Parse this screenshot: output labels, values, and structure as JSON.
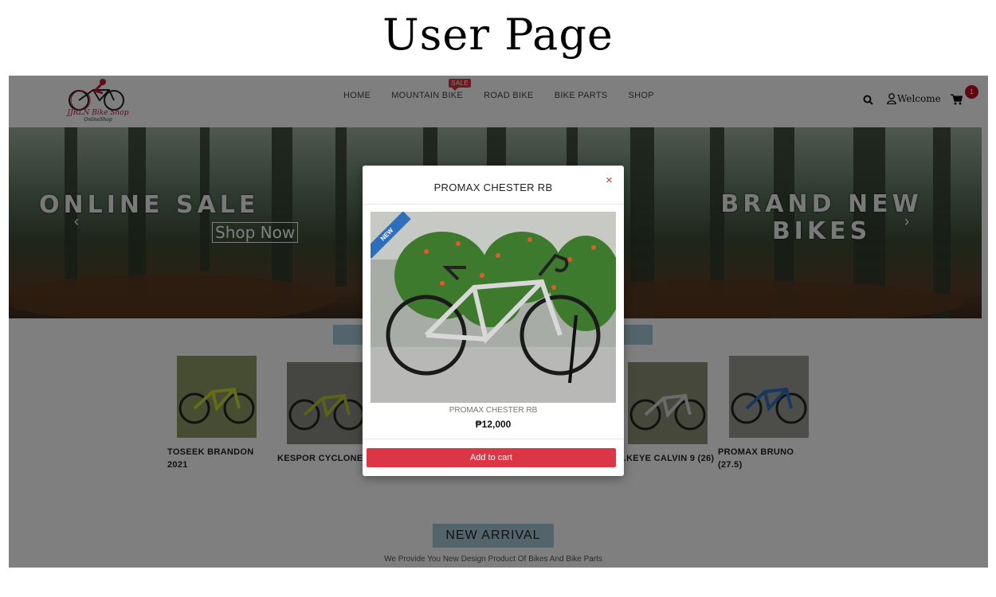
{
  "page_heading": "User Page",
  "header": {
    "logo_name": "JJRLN Bike Shop",
    "logo_sub": "OnlineShop",
    "nav": [
      "HOME",
      "MOUNTAIN BIKE",
      "ROAD BIKE",
      "BIKE PARTS",
      "SHOP"
    ],
    "sale_badge": "SALE",
    "welcome": "Welcome",
    "cart_count": "1"
  },
  "hero": {
    "left_title": "ONLINE SALE",
    "shop_now": "Shop Now",
    "right_title_1": "BRAND NEW",
    "right_title_2": "BIKES",
    "prev_arrow": "‹",
    "next_arrow": "›"
  },
  "products": [
    {
      "name_1": "TOSEEK BRANDON",
      "name_2": "2021"
    },
    {
      "name_1": "KESPOR CYCLONE",
      "name_2": ""
    },
    {
      "name_1": "...KEYE CALVIN 9 (26)",
      "name_2": ""
    },
    {
      "name_1": "PROMAX BRUNO",
      "name_2": "(27.5)"
    }
  ],
  "new_arrival": "NEW ARRIVAL",
  "tagline": "We Provide You New Design Product Of Bikes And Bike Parts",
  "modal": {
    "title": "PROMAX CHESTER RB",
    "close": "×",
    "ribbon": "NEW",
    "caption": "PROMAX CHESTER RB",
    "price": "₱12,000",
    "add_to_cart": "Add to cart"
  },
  "colors": {
    "accent_red": "#dc3545",
    "ribbon_blue": "#2e6fbd",
    "section_blue": "#a8c8d8",
    "overlay": "rgba(0,0,0,0.5)"
  }
}
